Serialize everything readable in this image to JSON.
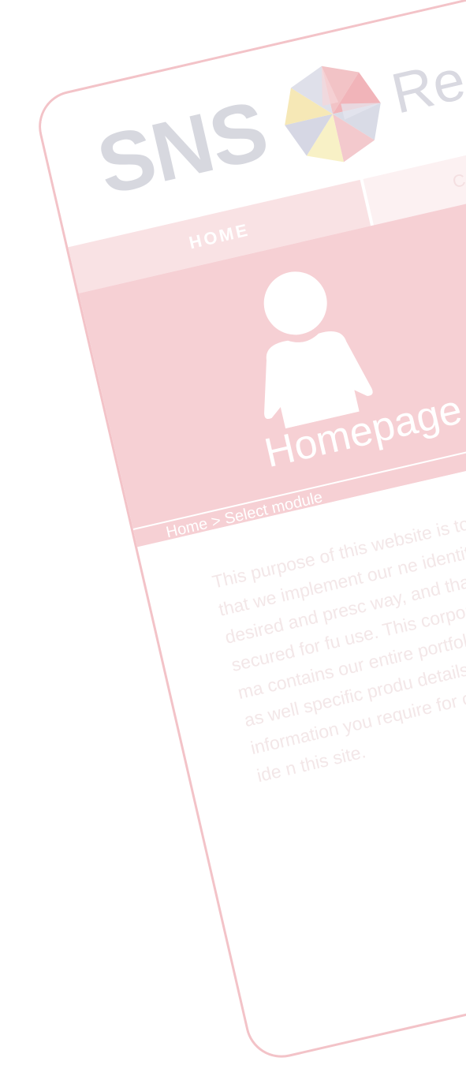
{
  "header": {
    "logo_text": "SNS",
    "logo_tag": "Reg"
  },
  "nav": {
    "home_label": "HOME",
    "second_label": "C"
  },
  "hero": {
    "title": "Homepage",
    "breadcrumb": "Home > Select module"
  },
  "content": {
    "intro": "This purpose of this website is to ensure that we implement our ne identity in the desired and presc way, and that it is secured for fu use. This corporate identity ma contains our entire portfolio of rials, as as well specific produ details. All the information you require for our corporate ide n this site."
  },
  "colors": {
    "frame": "#f3c3c8",
    "hero_bg": "#f6d0d4",
    "tab_home_bg": "#f9e2e4",
    "logo": "#d7d8df"
  },
  "icons": {
    "person": "person-icon",
    "logo_star": "logo-star-icon"
  }
}
